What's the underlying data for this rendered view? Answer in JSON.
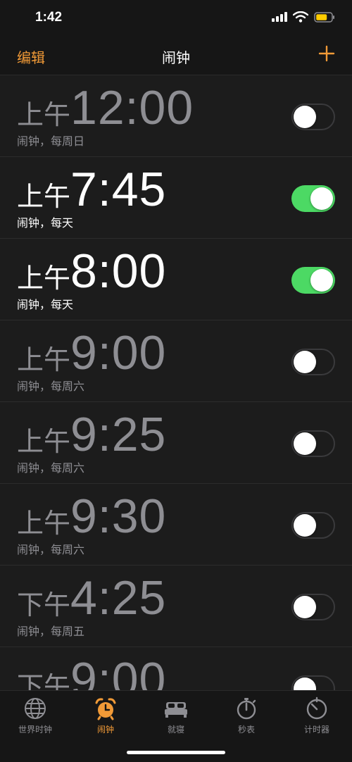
{
  "status": {
    "time": "1:42"
  },
  "nav": {
    "edit": "编辑",
    "title": "闹钟"
  },
  "colors": {
    "accent": "#f19a37",
    "toggle_on": "#4cd964"
  },
  "alarms": [
    {
      "ampm": "上午",
      "time": "12:00",
      "label": "闹钟，每周日",
      "enabled": false
    },
    {
      "ampm": "上午",
      "time": "7:45",
      "label": "闹钟，每天",
      "enabled": true
    },
    {
      "ampm": "上午",
      "time": "8:00",
      "label": "闹钟，每天",
      "enabled": true
    },
    {
      "ampm": "上午",
      "time": "9:00",
      "label": "闹钟，每周六",
      "enabled": false
    },
    {
      "ampm": "上午",
      "time": "9:25",
      "label": "闹钟，每周六",
      "enabled": false
    },
    {
      "ampm": "上午",
      "time": "9:30",
      "label": "闹钟，每周六",
      "enabled": false
    },
    {
      "ampm": "下午",
      "time": "4:25",
      "label": "闹钟，每周五",
      "enabled": false
    },
    {
      "ampm": "下午",
      "time": "9:00",
      "label": "",
      "enabled": false
    }
  ],
  "tabs": [
    {
      "label": "世界时钟",
      "icon": "globe-icon"
    },
    {
      "label": "闹钟",
      "icon": "alarm-clock-icon"
    },
    {
      "label": "就寝",
      "icon": "bed-icon"
    },
    {
      "label": "秒表",
      "icon": "stopwatch-icon"
    },
    {
      "label": "计时器",
      "icon": "timer-icon"
    }
  ]
}
